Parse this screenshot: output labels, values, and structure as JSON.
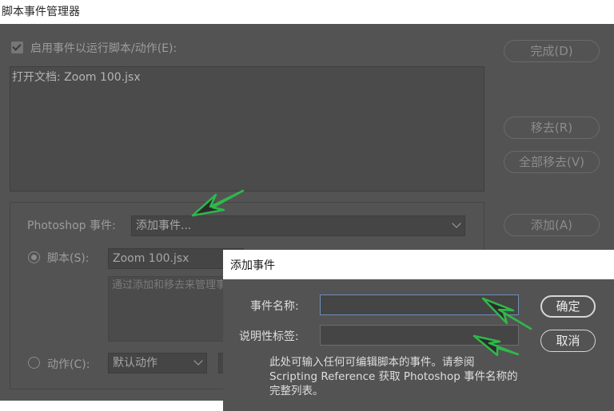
{
  "window": {
    "title": "脚本事件管理器"
  },
  "main": {
    "enable_checkbox_label": "启用事件以运行脚本/动作(E):",
    "event_list": [
      "打开文档: Zoom 100.jsx"
    ],
    "photoshop_event_label": "Photoshop 事件:",
    "photoshop_event_value": "添加事件...",
    "script_label": "脚本(S):",
    "script_value": "Zoom 100.jsx",
    "description_text": "通过添加和移去来管理事件以获得详细说明。",
    "action_label": "动作(C):",
    "action_value": "默认动作"
  },
  "buttons": {
    "done": "完成(D)",
    "remove": "移去(R)",
    "remove_all": "全部移去(V)",
    "add": "添加(A)"
  },
  "dialog": {
    "title": "添加事件",
    "event_name_label": "事件名称:",
    "event_name_value": "",
    "descriptive_label": "说明性标签:",
    "descriptive_value": "",
    "ok": "确定",
    "cancel": "取消",
    "hint": "此处可输入任何可编辑脚本的事件。请参阅 Scripting Reference 获取 Photoshop 事件名称的完整列表。"
  },
  "annotations": {
    "arrow_color": "#2fb84a"
  },
  "colors": {
    "panel_bg": "#535353",
    "field_bg": "#454545",
    "focus_border": "#6d8eb8"
  }
}
